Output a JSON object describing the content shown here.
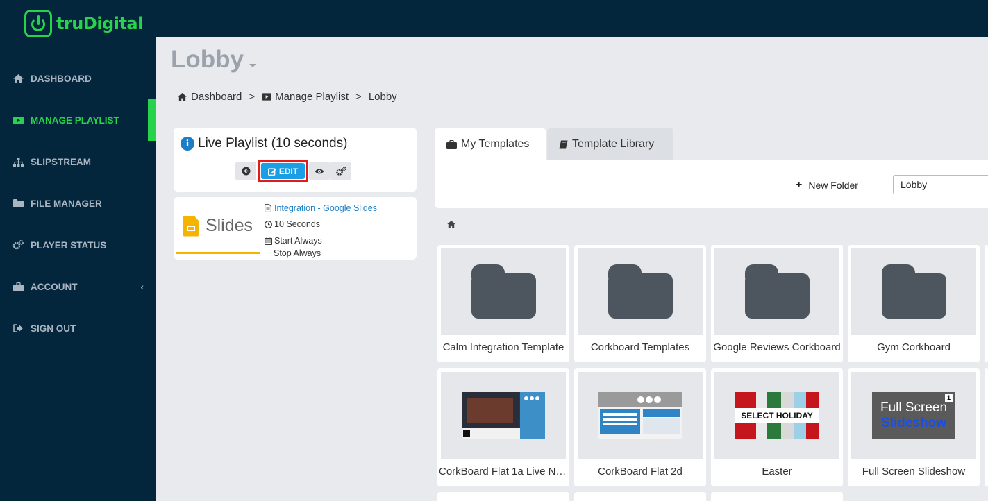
{
  "brand": {
    "name": "truDigital",
    "accent": "#27d34a",
    "sidebar_bg": "#04263d"
  },
  "sidebar": {
    "items": [
      {
        "label": "DASHBOARD",
        "icon": "home-icon"
      },
      {
        "label": "MANAGE PLAYLIST",
        "icon": "play-icon",
        "active": true
      },
      {
        "label": "SLIPSTREAM",
        "icon": "sitemap-icon"
      },
      {
        "label": "FILE MANAGER",
        "icon": "folder-icon"
      },
      {
        "label": "PLAYER STATUS",
        "icon": "cogs-icon"
      },
      {
        "label": "ACCOUNT",
        "icon": "briefcase-icon",
        "chevron": "‹"
      },
      {
        "label": "SIGN OUT",
        "icon": "sign-out-icon"
      }
    ]
  },
  "page": {
    "title": "Lobby"
  },
  "breadcrumb": {
    "items": [
      "Dashboard",
      "Manage Playlist",
      "Lobby"
    ],
    "separator": ">"
  },
  "live_playlist": {
    "title": "Live Playlist (10 seconds)",
    "edit_label": "EDIT"
  },
  "playlist_item": {
    "thumb_label": "Slides",
    "name": "Integration - Google Slides",
    "duration": "10 Seconds",
    "start": "Start Always",
    "stop": "Stop Always"
  },
  "tabs": [
    {
      "label": "My Templates",
      "active": true,
      "icon": "briefcase-icon"
    },
    {
      "label": "Template Library",
      "active": false,
      "icon": "book-icon"
    }
  ],
  "templates_toolbar": {
    "new_folder_label": "New Folder",
    "folder_value": "Lobby"
  },
  "templates": [
    {
      "label": "Calm Integration Template",
      "kind": "folder"
    },
    {
      "label": "Corkboard Templates",
      "kind": "folder"
    },
    {
      "label": "Google Reviews Corkboard",
      "kind": "folder"
    },
    {
      "label": "Gym Corkboard",
      "kind": "folder"
    },
    {
      "label": "CorkBoard Flat 1a Live Ne...",
      "kind": "template"
    },
    {
      "label": "CorkBoard Flat 2d",
      "kind": "template"
    },
    {
      "label": "Easter",
      "kind": "template",
      "thumb_text": "SELECT HOLIDAY"
    },
    {
      "label": "Full Screen Slideshow",
      "kind": "template",
      "thumb_line1": "Full Screen",
      "thumb_line2": "Slideshow",
      "badge": "1"
    }
  ]
}
